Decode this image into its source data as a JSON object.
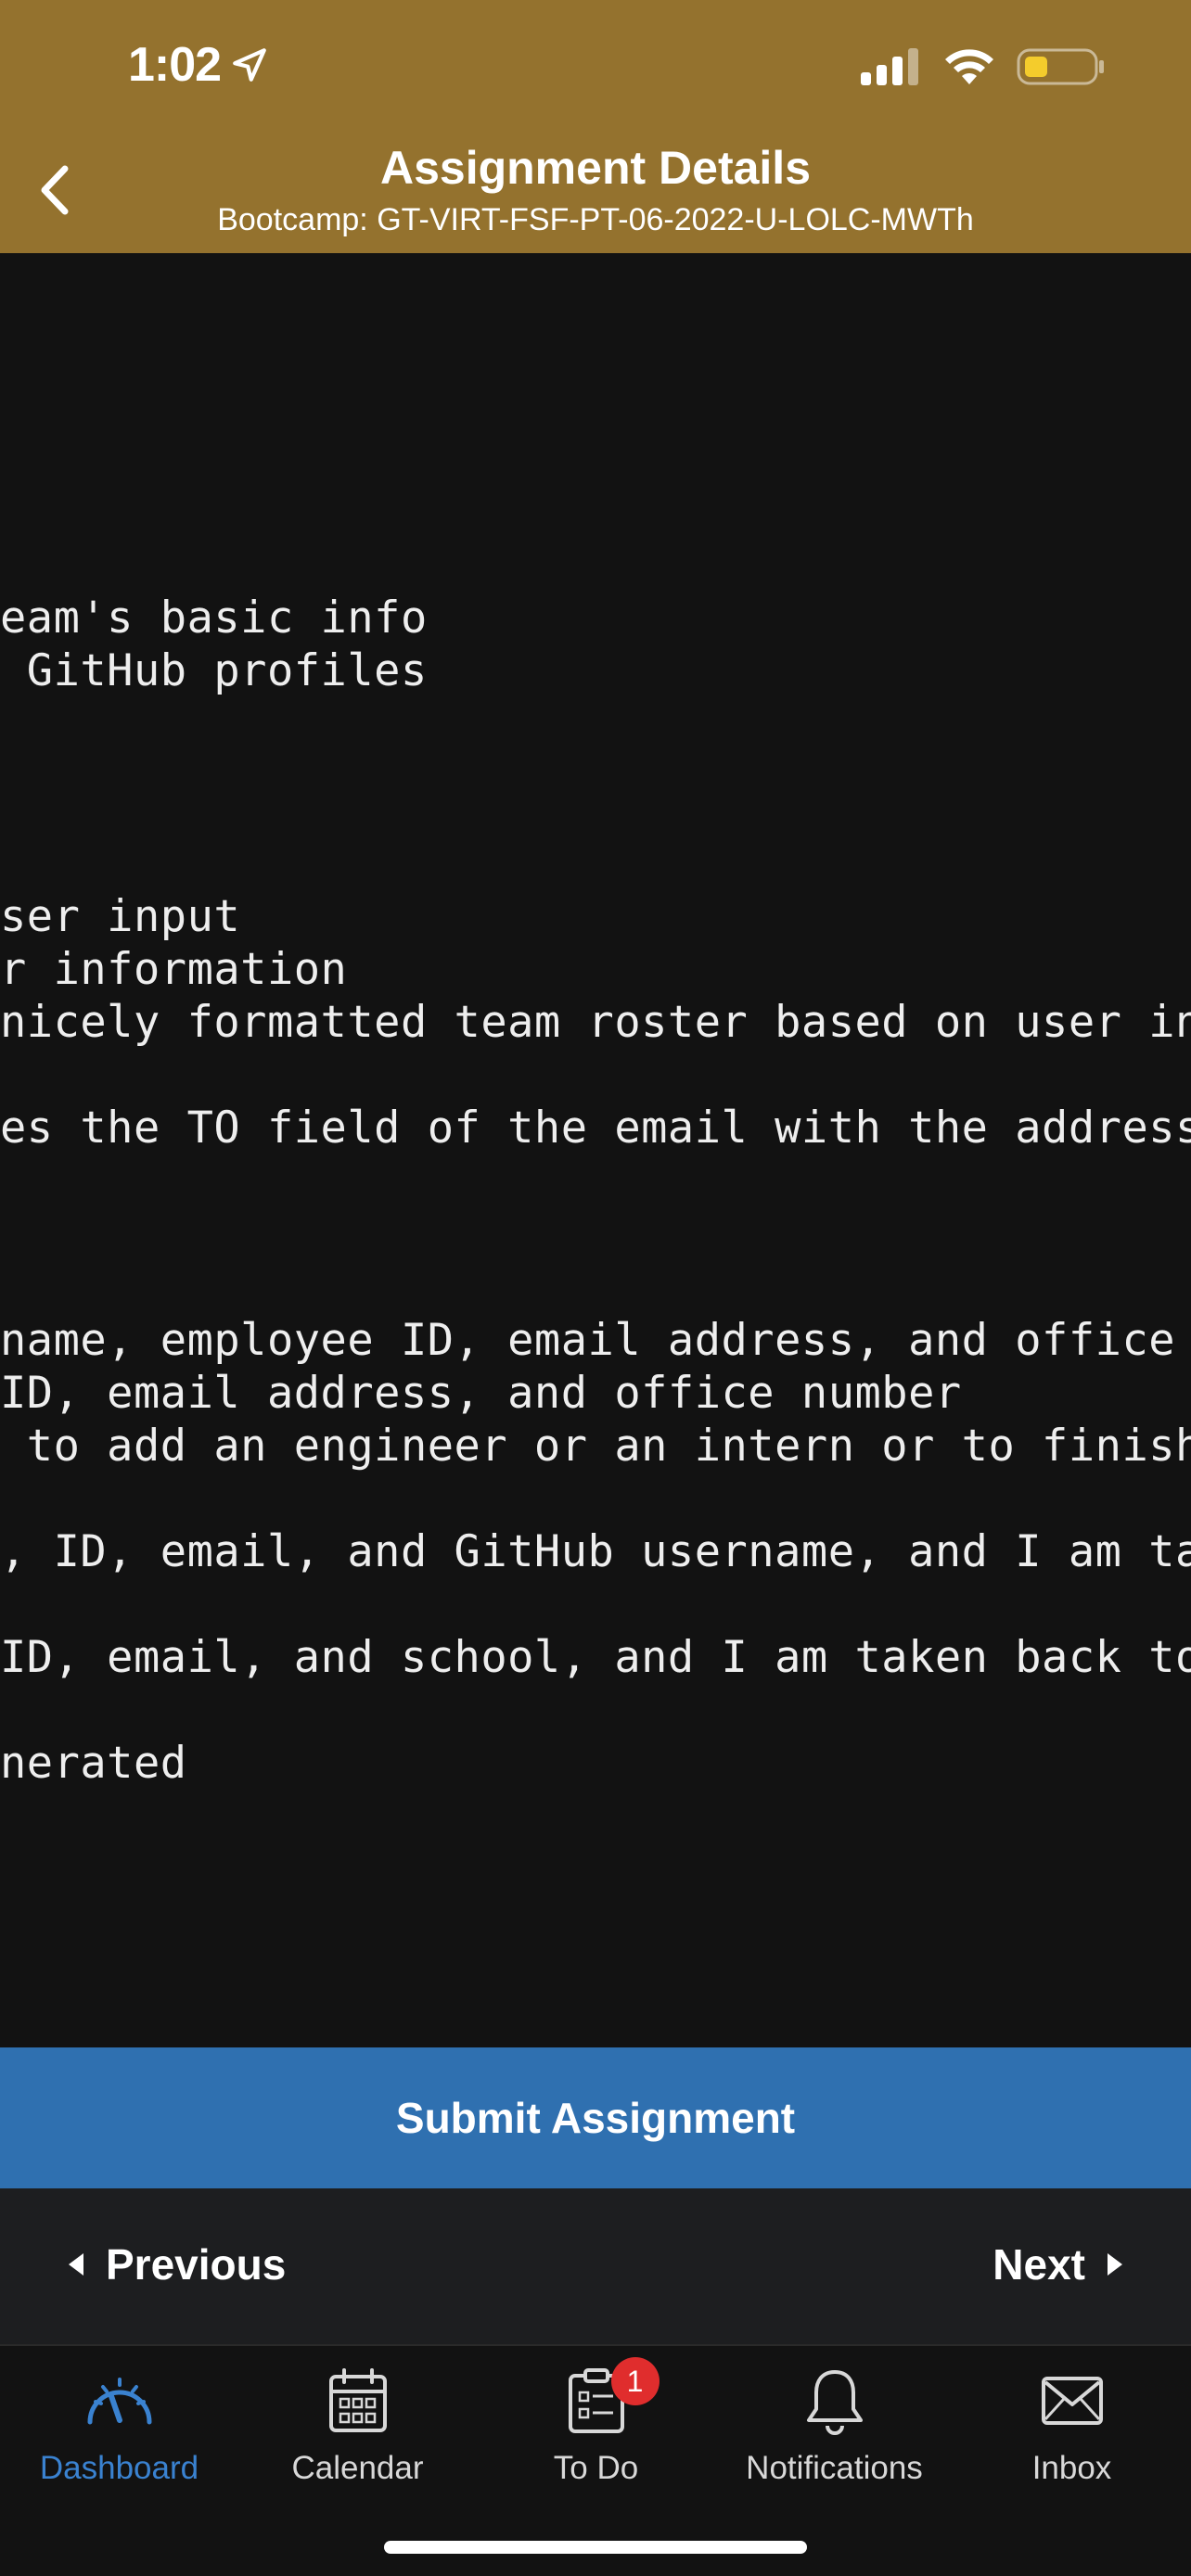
{
  "status_bar": {
    "time": "1:02"
  },
  "header": {
    "title": "Assignment Details",
    "subtitle": "Bootcamp: GT-VIRT-FSF-PT-06-2022-U-LOLC-MWTh"
  },
  "content": {
    "lines": [
      "eam's basic info",
      " GitHub profiles",
      "ser input",
      "r information",
      "nicely formatted team roster based on user in",
      "es the TO field of the email with the address",
      "name, employee ID, email address, and office ",
      "ID, email address, and office number",
      " to add an engineer or an intern or to finish",
      ", ID, email, and GitHub username, and I am ta",
      "ID, email, and school, and I am taken back to",
      "nerated"
    ]
  },
  "submit_button": {
    "label": "Submit Assignment"
  },
  "pager": {
    "previous_label": "Previous",
    "next_label": "Next"
  },
  "tabbar": {
    "tabs": [
      {
        "label": "Dashboard",
        "icon": "dashboard-gauge-icon",
        "active": true
      },
      {
        "label": "Calendar",
        "icon": "calendar-icon"
      },
      {
        "label": "To Do",
        "icon": "todo-clipboard-icon",
        "badge": "1"
      },
      {
        "label": "Notifications",
        "icon": "bell-icon"
      },
      {
        "label": "Inbox",
        "icon": "envelope-icon"
      }
    ]
  },
  "colors": {
    "header": "#94722e",
    "submit": "#2f70b0",
    "active_tab": "#3a82d0",
    "badge": "#e02d2d"
  }
}
